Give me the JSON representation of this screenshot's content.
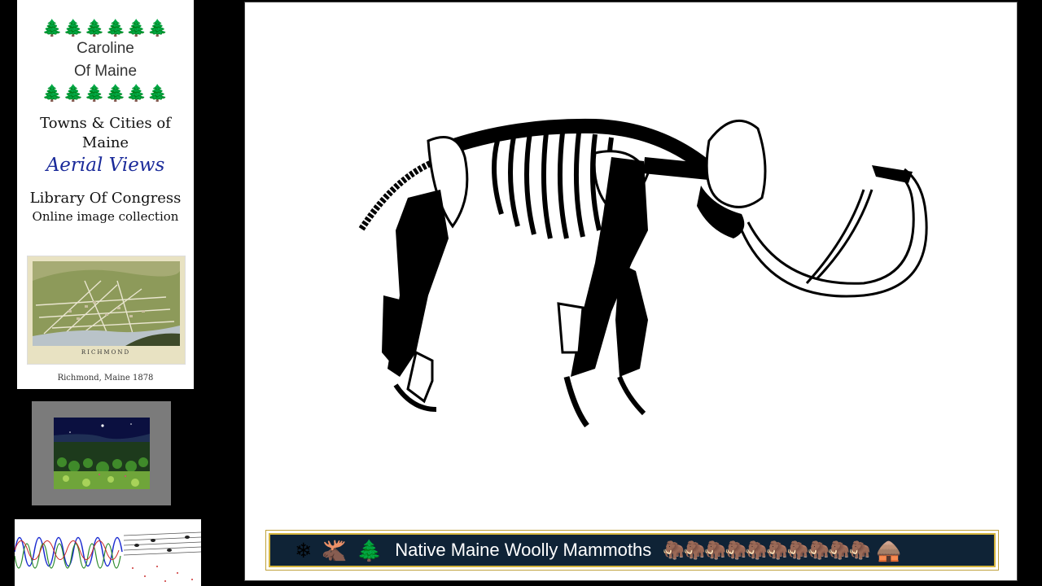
{
  "promo_card": {
    "tree_row": "🌲🌲🌲🌲🌲🌲",
    "brand_line1": "Caroline",
    "brand_line2": "Of Maine",
    "towns_title": "Towns & Cities of Maine",
    "aerial_title": "Aerial Views",
    "library_line1": "Library Of Congress",
    "library_line2": "Online image collection",
    "map_caption": "Richmond, Maine 1878",
    "map_label": "RICHMOND"
  },
  "caption_bar": {
    "icons": [
      "snowflake-icon",
      "moose-icon",
      "evergreen-tree-icon"
    ],
    "icon_glyphs": [
      "❄",
      "🫎",
      "🌲"
    ],
    "title": "Native Maine Woolly Mammoths",
    "mammoth_row": "🦣🦣🦣🦣🦣🦣🦣🦣🦣🦣",
    "end_icon_glyph": "🛖",
    "end_icon": "hut-icon"
  },
  "colors": {
    "background": "#000000",
    "caption_bg": "#0f2336",
    "caption_border": "#d4b43c",
    "aerial_title": "#1a2a9a",
    "tree_green": "#1b8f2f"
  }
}
